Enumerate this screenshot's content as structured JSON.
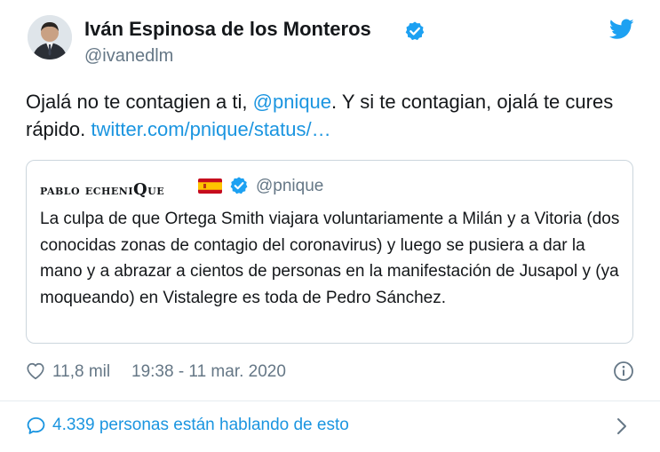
{
  "author": {
    "name": "Iván Espinosa de los Monteros",
    "handle": "@ivanedlm",
    "verified": true
  },
  "tweet": {
    "text_prefix": "Ojalá no te contagien a ti, ",
    "mention": "@pnique",
    "text_middle": ". Y si te contagian, ojalá te cures rápido. ",
    "link": "twitter.com/pnique/status/…"
  },
  "quoted": {
    "name_prefix": "pablo echeni",
    "name_cap": "Q",
    "name_suffix": "ue",
    "flag": "spain-flag",
    "verified": true,
    "handle": "@pnique",
    "text": "La culpa de que Ortega Smith viajara voluntariamente a Milán y a Vitoria (dos conocidas zonas de contagio del coronavirus) y luego se pusiera a dar la mano y a abrazar a cientos de personas en la manifestación de Jusapol y (ya moqueando) en Vistalegre es toda de Pedro Sánchez."
  },
  "footer": {
    "likes": "11,8 mil",
    "timestamp": "19:38 - 11 mar. 2020",
    "conversation": "4.339 personas están hablando de esto"
  },
  "icons": {
    "brand": "twitter-bird-icon",
    "like": "heart-icon",
    "info": "info-icon",
    "conversation": "speech-bubble-icon",
    "more": "chevron-right-icon"
  },
  "colors": {
    "text": "#14171a",
    "secondary": "#657786",
    "link": "#1b95e0",
    "verified": "#1da1f2",
    "border": "#ccd6dd"
  }
}
